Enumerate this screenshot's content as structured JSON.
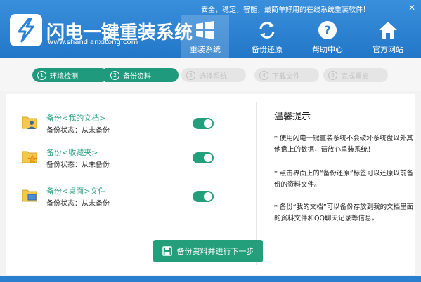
{
  "window": {
    "slogan": "安全，稳定，智能，最简单好用的在线系统重装软件！",
    "minimize_label": "–",
    "close_label": "✕"
  },
  "logo": {
    "title": "闪电一键重装系统",
    "subtitle": "www.shandianxitong.com",
    "icon": "lightning-icon"
  },
  "nav": [
    {
      "label": "重装系统",
      "icon": "windows-icon",
      "active": true
    },
    {
      "label": "备份还原",
      "icon": "refresh-icon",
      "active": false
    },
    {
      "label": "帮助中心",
      "icon": "question-icon",
      "active": false
    },
    {
      "label": "官方网站",
      "icon": "home-icon",
      "active": false
    }
  ],
  "steps": [
    {
      "num": "1",
      "label": "环境检测",
      "done": true
    },
    {
      "num": "2",
      "label": "备份资料",
      "done": true
    },
    {
      "num": "3",
      "label": "选择系统",
      "done": false
    },
    {
      "num": "4",
      "label": "下载文件",
      "done": false
    },
    {
      "num": "5",
      "label": "完成重启",
      "done": false
    }
  ],
  "backup_items": [
    {
      "title": "备份<我的文档>",
      "status": "备份状态：从未备份",
      "icon": "user-folder-icon",
      "enabled": true
    },
    {
      "title": "备份<收藏夹>",
      "status": "备份状态：从未备份",
      "icon": "favorites-folder-icon",
      "enabled": true
    },
    {
      "title": "备份<桌面>文件",
      "status": "备份状态：从未备份",
      "icon": "desktop-folder-icon",
      "enabled": true
    }
  ],
  "tips": {
    "title": "温馨提示",
    "items": [
      "* 使用闪电一键重装系统不会破坏系统盘以外其他盘上的数据，请放心重装系统！",
      "* 点击界面上的“备份还原”标签可以还原以前备份的资料文件。",
      "* 备份“我的文档”可以备份存放到我的文档里面的资料文件和QQ聊天记录等信息。"
    ]
  },
  "next_button": {
    "label": "备份资料并进行下一步",
    "icon": "disk-icon"
  },
  "colors": {
    "brand_blue": "#2a82d6",
    "accent_green": "#23a07b"
  }
}
